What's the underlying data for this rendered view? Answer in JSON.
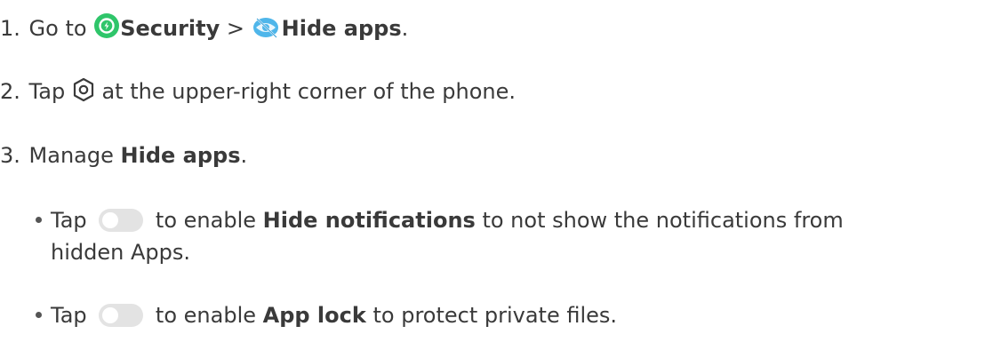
{
  "steps": [
    {
      "number": "1.",
      "text_go_to": "Go to",
      "security_label": "Security",
      "separator": ">",
      "hide_apps_label": "Hide apps",
      "end": ".",
      "security_icon": "security-app-icon",
      "hide_apps_icon": "hidden-eye-icon"
    },
    {
      "number": "2.",
      "text_tap": "Tap",
      "settings_icon": "settings-gear-icon",
      "text_rest": "at the upper-right corner of the phone."
    },
    {
      "number": "3.",
      "text_manage": "Manage",
      "hide_apps_label": "Hide apps",
      "end": "."
    }
  ],
  "sub_items": [
    {
      "text_tap": "Tap",
      "toggle_state": "off",
      "text_enable": "to enable",
      "feature_label": "Hide notifications",
      "text_rest_line1": "to not show the notifications from",
      "text_rest_line2": "hidden Apps."
    },
    {
      "text_tap": "Tap",
      "toggle_state": "off",
      "text_enable": "to enable",
      "feature_label": "App lock",
      "text_rest": "to protect private files."
    }
  ],
  "colors": {
    "text": "#3a3a3a",
    "security_icon_green": "#2fc56a",
    "hide_icon_blue": "#4fb6ea",
    "toggle_off": "#e3e3e3"
  }
}
